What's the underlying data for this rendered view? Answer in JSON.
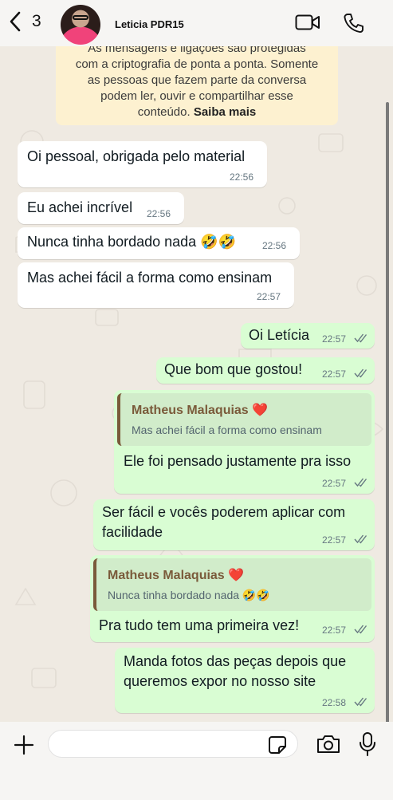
{
  "header": {
    "back_count": "3",
    "contact_name": "Leticia PDR15",
    "icons": {
      "back": "chevron-left-icon",
      "video": "video-camera-icon",
      "call": "phone-icon"
    }
  },
  "notice": {
    "line1": "As mensagens e ligações são protegidas",
    "line2": "com a criptografia de ponta a ponta. Somente",
    "line3": "as pessoas que fazem parte da conversa",
    "line4": "podem ler, ouvir e compartilhar esse",
    "line5_text": "conteúdo. ",
    "line5_link": "Saiba mais"
  },
  "messages": [
    {
      "text": "Oi pessoal, obrigada pelo material",
      "time": "22:56"
    },
    {
      "text": "Eu achei incrível",
      "time": "22:56"
    },
    {
      "text": "Nunca tinha bordado nada 🤣🤣",
      "time": "22:56"
    },
    {
      "text": "Mas achei fácil a forma como ensinam",
      "time": "22:57"
    },
    {
      "text": "Oi Letícia",
      "time": "22:57"
    },
    {
      "text": "Que bom que gostou!",
      "time": "22:57"
    },
    {
      "reply_author": "Matheus Malaquias ❤️",
      "reply_text": "Mas achei fácil a forma como ensinam",
      "text": "Ele foi pensado justamente pra isso",
      "time": "22:57"
    },
    {
      "text_line1": "Ser fácil e vocês poderem aplicar com",
      "text_line2": "facilidade",
      "time": "22:57"
    },
    {
      "reply_author": "Matheus Malaquias ❤️",
      "reply_text": "Nunca tinha bordado nada 🤣🤣",
      "text": "Pra tudo tem uma primeira vez!",
      "time": "22:57"
    },
    {
      "text_line1": "Manda fotos das peças depois que",
      "text_line2": "queremos expor no nosso site",
      "time": "22:58"
    }
  ],
  "composer": {
    "input_value": "",
    "icons": {
      "add": "plus-icon",
      "sticker": "sticker-icon",
      "camera": "camera-icon",
      "mic": "microphone-icon"
    }
  },
  "colors": {
    "incoming": "#ffffff",
    "outgoing": "#d9fdd3",
    "notice": "#fdf1d0",
    "read_check": "#667781"
  }
}
